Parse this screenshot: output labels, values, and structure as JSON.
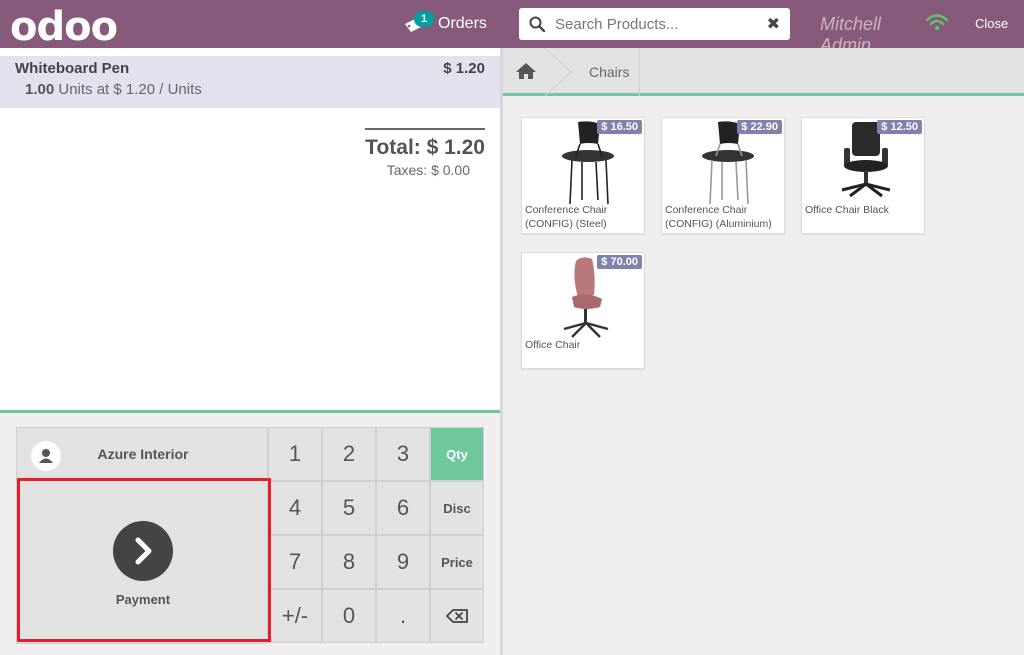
{
  "header": {
    "logo": "odoo",
    "orders_badge": "1",
    "orders_label": "Orders",
    "search_placeholder": "Search Products...",
    "user_name": "Mitchell Admin",
    "close_label": "Close"
  },
  "order": {
    "line": {
      "product": "Whiteboard Pen",
      "price": "$ 1.20",
      "qty": "1.00",
      "unit_info": "Units at $ 1.20 / Units"
    },
    "total": "Total: $ 1.20",
    "taxes": "Taxes: $ 0.00"
  },
  "numpad": {
    "customer": "Azure Interior",
    "payment": "Payment",
    "keys": {
      "k1": "1",
      "k2": "2",
      "k3": "3",
      "k4": "4",
      "k5": "5",
      "k6": "6",
      "k7": "7",
      "k8": "8",
      "k9": "9",
      "plusminus": "+/-",
      "k0": "0",
      "dot": "."
    },
    "modes": {
      "qty": "Qty",
      "disc": "Disc",
      "price": "Price"
    }
  },
  "breadcrumb": {
    "category": "Chairs"
  },
  "products": [
    {
      "name": "Conference Chair (CONFIG) (Steel)",
      "price": "$ 16.50"
    },
    {
      "name": "Conference Chair (CONFIG) (Aluminium)",
      "price": "$ 22.90"
    },
    {
      "name": "Office Chair Black",
      "price": "$ 12.50"
    },
    {
      "name": "Office Chair",
      "price": "$ 70.00"
    }
  ],
  "colors": {
    "topbar": "#875a7b",
    "accent_green": "#6ec89b",
    "price_tag": "#7f82ac",
    "highlight": "#e3202a"
  }
}
